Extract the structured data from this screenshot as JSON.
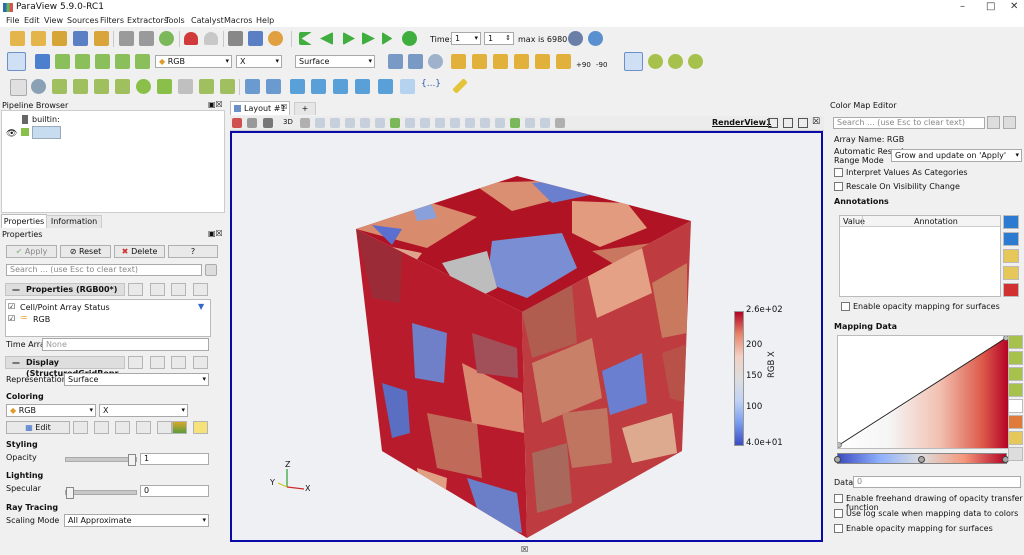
{
  "app_title": "ParaView 5.9.0-RC1",
  "menu": [
    "File",
    "Edit",
    "View",
    "Sources",
    "Filters",
    "Extractors",
    "Tools",
    "Catalyst",
    "Macros",
    "Help"
  ],
  "toolbar": {
    "time_label": "Time:",
    "time_value": "1",
    "time_index": "1",
    "max_label": "max is 6980",
    "array_combo": "RGB",
    "component_combo": "X",
    "representation_combo": "Surface",
    "rot_plus": "+90",
    "rot_minus": "-90"
  },
  "pipeline": {
    "title": "Pipeline Browser",
    "root": "builtin:"
  },
  "properties_panel": {
    "tabs": [
      "Properties",
      "Information"
    ],
    "title": "Properties",
    "apply": "Apply",
    "reset": "Reset",
    "delete": "Delete",
    "help": "?",
    "search_placeholder": "Search ... (use Esc to clear text)",
    "section_properties": "Properties (RGB00*)",
    "array_status_label": "Cell/Point Array Status",
    "array_item": "RGB",
    "time_array_label": "Time Array",
    "time_array_value": "None",
    "section_display": "Display (StructuredGridRepr",
    "representation_label": "Representation",
    "representation_value": "Surface",
    "coloring_label": "Coloring",
    "coloring_array": "RGB",
    "coloring_component": "X",
    "edit_button": "Edit",
    "styling_label": "Styling",
    "opacity_label": "Opacity",
    "opacity_value": "1",
    "opacity_level": 1.0,
    "lighting_label": "Lighting",
    "specular_label": "Specular",
    "specular_value": "0",
    "specular_level": 0.0,
    "raytracing_label": "Ray Tracing",
    "scaling_mode_label": "Scaling Mode",
    "scaling_mode_value": "All Approximate"
  },
  "layout": {
    "tab": "Layout #1",
    "add_tab": "+",
    "view_3d": "3D",
    "render_view": "RenderView1"
  },
  "colorbar": {
    "title": "RGB X",
    "ticks": [
      "2.6e+02",
      "200",
      "150",
      "100",
      "4.0e+01"
    ]
  },
  "axes": {
    "x": "X",
    "y": "Y",
    "z": "Z"
  },
  "colormap_editor": {
    "title": "Color Map Editor",
    "search_placeholder": "Search ... (use Esc to clear text)",
    "array_name": "Array Name: RGB",
    "rescale_label_1": "Automatic Rescale",
    "rescale_label_2": "Range Mode",
    "rescale_value": "Grow and update on 'Apply'",
    "interpret_label": "Interpret Values As Categories",
    "rescale_visibility_label": "Rescale On Visibility Change",
    "annotations_label": "Annotations",
    "col_value": "Value",
    "col_annotation": "Annotation",
    "opacity_surfaces_label": "Enable opacity mapping for surfaces",
    "mapping_data_label": "Mapping Data",
    "data_label": "Data:",
    "data_value": "0",
    "freehand_label": "Enable freehand drawing of opacity transfer function",
    "log_scale_label": "Use log scale when mapping data to colors",
    "opacity_surfaces_label2": "Enable opacity mapping for surfaces"
  },
  "colors": {
    "accent_blue": "#0a0aa8",
    "cmap_low": "#3b4cc0",
    "cmap_mid": "#dddddd",
    "cmap_high": "#b40426"
  }
}
